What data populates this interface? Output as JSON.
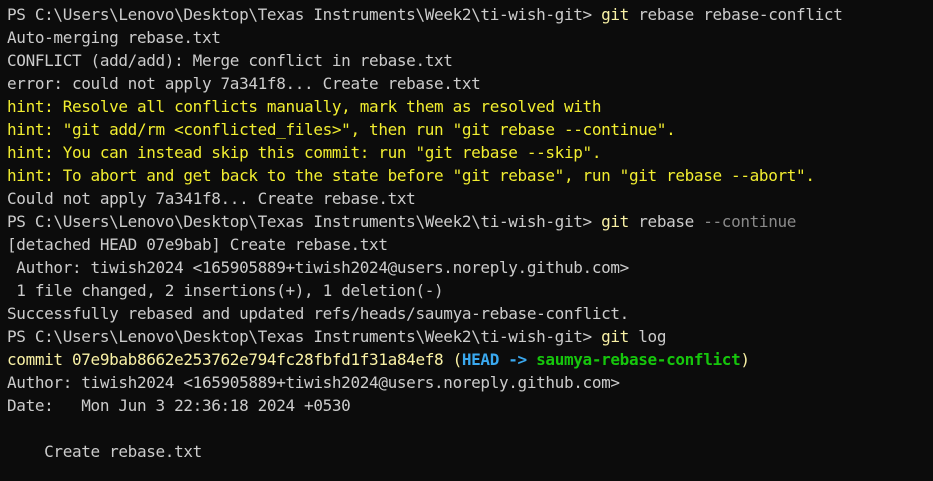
{
  "terminal": {
    "colors": {
      "background": "#0c0c0c",
      "default": "#cccccc",
      "command": "#f9f1a5",
      "hint": "#f2ee30",
      "flag": "#8a8a8a",
      "head": "#3aa9f0",
      "branch": "#16c60c"
    },
    "lines": [
      {
        "segments": [
          {
            "text": "PS C:\\Users\\Lenovo\\Desktop\\Texas Instruments\\Week2\\ti-wish-git> ",
            "style": "default"
          },
          {
            "text": "git",
            "style": "yellow"
          },
          {
            "text": " rebase rebase-conflict",
            "style": "default"
          }
        ]
      },
      {
        "segments": [
          {
            "text": "Auto-merging rebase.txt",
            "style": "default"
          }
        ]
      },
      {
        "segments": [
          {
            "text": "CONFLICT (add/add): Merge conflict in rebase.txt",
            "style": "default"
          }
        ]
      },
      {
        "segments": [
          {
            "text": "error: could not apply 7a341f8... Create rebase.txt",
            "style": "default"
          }
        ]
      },
      {
        "segments": [
          {
            "text": "hint: Resolve all conflicts manually, mark them as resolved with",
            "style": "hint"
          }
        ]
      },
      {
        "segments": [
          {
            "text": "hint: \"git add/rm <conflicted_files>\", then run \"git rebase --continue\".",
            "style": "hint"
          }
        ]
      },
      {
        "segments": [
          {
            "text": "hint: You can instead skip this commit: run \"git rebase --skip\".",
            "style": "hint"
          }
        ]
      },
      {
        "segments": [
          {
            "text": "hint: To abort and get back to the state before \"git rebase\", run \"git rebase --abort\".",
            "style": "hint"
          }
        ]
      },
      {
        "segments": [
          {
            "text": "Could not apply 7a341f8... Create rebase.txt",
            "style": "default"
          }
        ]
      },
      {
        "segments": [
          {
            "text": "PS C:\\Users\\Lenovo\\Desktop\\Texas Instruments\\Week2\\ti-wish-git> ",
            "style": "default"
          },
          {
            "text": "git",
            "style": "yellow"
          },
          {
            "text": " rebase ",
            "style": "default"
          },
          {
            "text": "--continue",
            "style": "gray"
          }
        ]
      },
      {
        "segments": [
          {
            "text": "[detached HEAD 07e9bab] Create rebase.txt",
            "style": "default"
          }
        ]
      },
      {
        "segments": [
          {
            "text": " Author: tiwish2024 <165905889+tiwish2024@users.noreply.github.com>",
            "style": "default"
          }
        ]
      },
      {
        "segments": [
          {
            "text": " 1 file changed, 2 insertions(+), 1 deletion(-)",
            "style": "default"
          }
        ]
      },
      {
        "segments": [
          {
            "text": "Successfully rebased and updated refs/heads/saumya-rebase-conflict.",
            "style": "default"
          }
        ]
      },
      {
        "segments": [
          {
            "text": "PS C:\\Users\\Lenovo\\Desktop\\Texas Instruments\\Week2\\ti-wish-git> ",
            "style": "default"
          },
          {
            "text": "git",
            "style": "yellow"
          },
          {
            "text": " log",
            "style": "default"
          }
        ]
      },
      {
        "segments": [
          {
            "text": "commit 07e9bab8662e253762e794fc28fbfd1f31a84ef8 (",
            "style": "yellow"
          },
          {
            "text": "HEAD -> ",
            "style": "cyan"
          },
          {
            "text": "saumya-rebase-conflict",
            "style": "green"
          },
          {
            "text": ")",
            "style": "yellow"
          }
        ]
      },
      {
        "segments": [
          {
            "text": "Author: tiwish2024 <165905889+tiwish2024@users.noreply.github.com>",
            "style": "default"
          }
        ]
      },
      {
        "segments": [
          {
            "text": "Date:   Mon Jun 3 22:36:18 2024 +0530",
            "style": "default"
          }
        ]
      },
      {
        "segments": [
          {
            "text": "",
            "style": "default"
          }
        ]
      },
      {
        "segments": [
          {
            "text": "    Create rebase.txt",
            "style": "default"
          }
        ]
      }
    ]
  }
}
